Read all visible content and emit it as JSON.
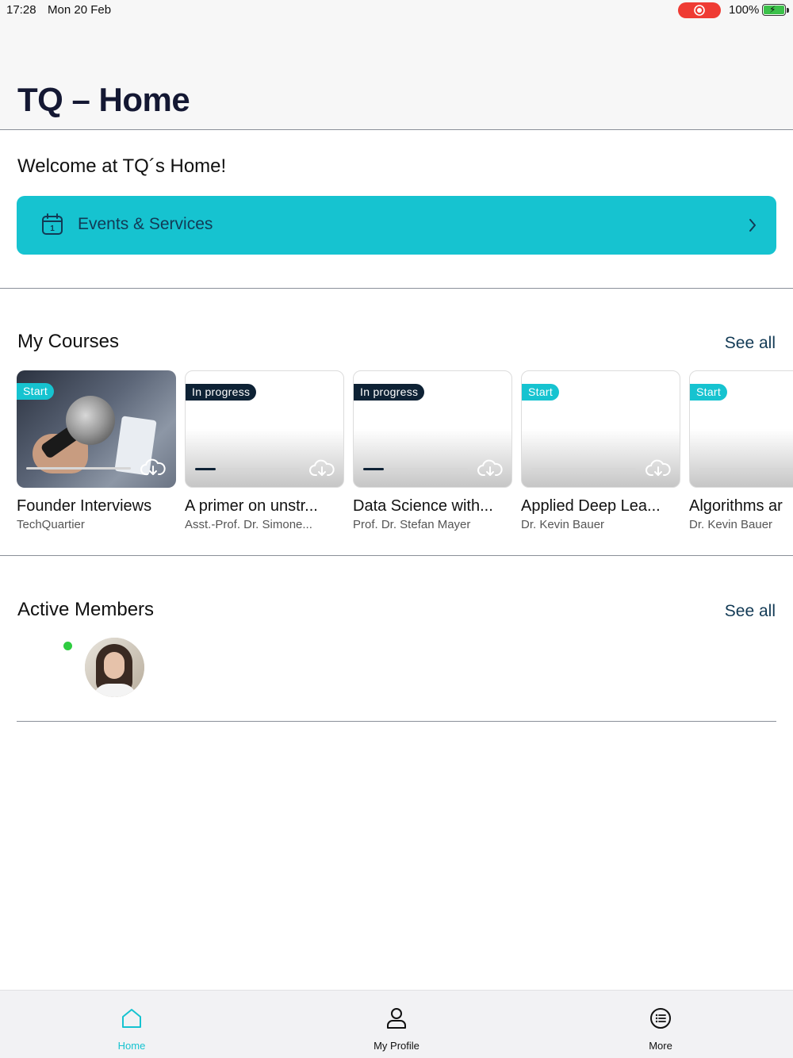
{
  "status_bar": {
    "time": "17:28",
    "date": "Mon 20 Feb",
    "battery": "100%"
  },
  "header": {
    "title": "TQ – Home"
  },
  "welcome": {
    "text": "Welcome at TQ´s Home!"
  },
  "events": {
    "label": "Events & Services",
    "icon": "calendar-icon"
  },
  "courses_section": {
    "title": "My Courses",
    "see_all": "See all",
    "courses": [
      {
        "badge": "Start",
        "title": "Founder Interviews",
        "subtitle": "TechQuartier",
        "progress": 0
      },
      {
        "badge": "In progress",
        "title": "A primer on unstr...",
        "subtitle": "Asst.-Prof. Dr. Simone...",
        "progress": 0.2
      },
      {
        "badge": "In progress",
        "title": "Data Science with...",
        "subtitle": "Prof. Dr. Stefan Mayer",
        "progress": 0.2
      },
      {
        "badge": "Start",
        "title": "Applied Deep Lea...",
        "subtitle": "Dr. Kevin Bauer",
        "progress": 0
      },
      {
        "badge": "Start",
        "title": "Algorithms ar",
        "subtitle": "Dr. Kevin Bauer",
        "progress": 0
      }
    ]
  },
  "members_section": {
    "title": "Active Members",
    "see_all": "See all"
  },
  "tabbar": {
    "items": [
      {
        "label": "Home",
        "icon": "home-icon",
        "active": true
      },
      {
        "label": "My Profile",
        "icon": "profile-icon",
        "active": false
      },
      {
        "label": "More",
        "icon": "more-list-icon",
        "active": false
      }
    ]
  },
  "colors": {
    "accent": "#16c3d0",
    "dark": "#0e2235",
    "title": "#141833"
  }
}
